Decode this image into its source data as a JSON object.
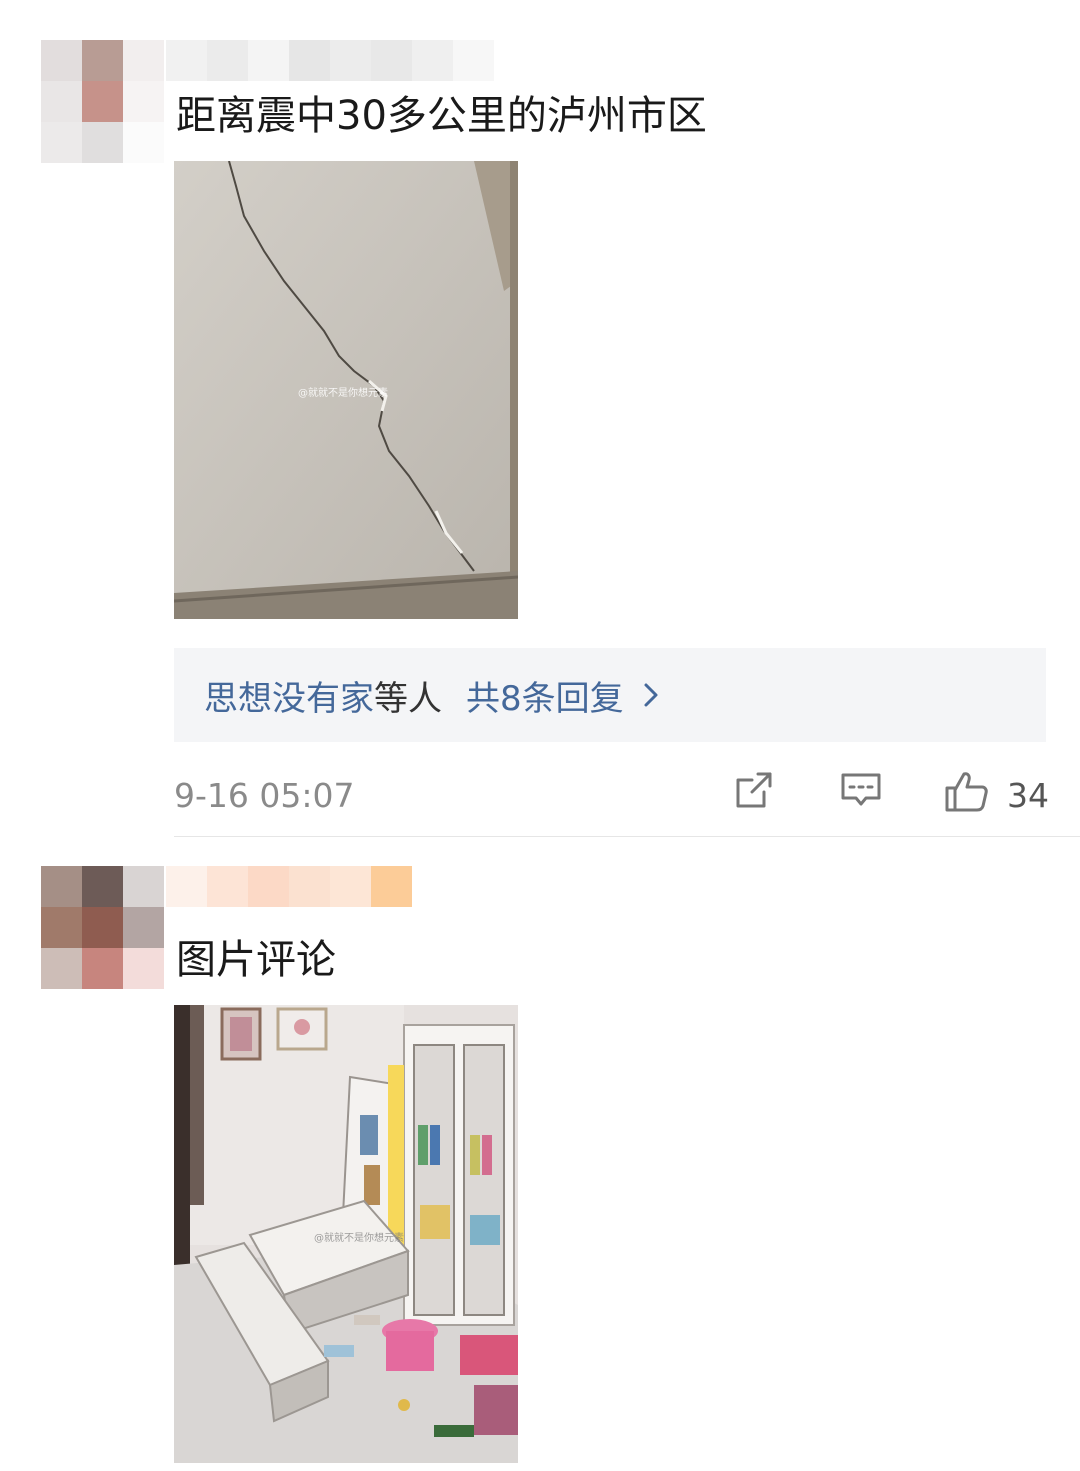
{
  "comments": [
    {
      "text": "距离震中30多公里的泸州市区",
      "image_watermark": "@就就不是你想元素",
      "replies": {
        "users": "思想没有家",
        "suffix": "等人",
        "count_label": "共8条回复"
      },
      "timestamp": "9-16 05:07",
      "like_count": "34"
    },
    {
      "text": "图片评论",
      "image_watermark": "@就就不是你想元素"
    }
  ],
  "icons": {
    "share": "share-icon",
    "comment": "comment-icon",
    "like": "thumbs-up-icon",
    "chevron": "chevron-right-icon"
  },
  "colors": {
    "link": "#44689a",
    "meta": "#8a8a8a",
    "reply_bg": "#f4f5f7"
  }
}
